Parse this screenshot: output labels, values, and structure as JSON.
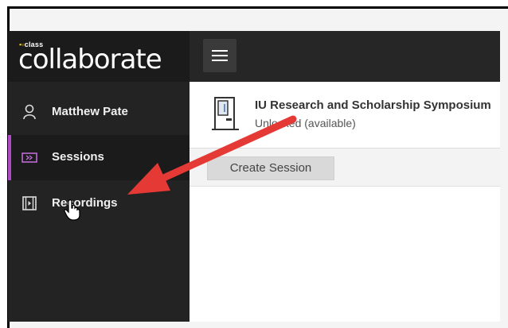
{
  "brand": {
    "small": "class",
    "name": "collaborate"
  },
  "sidebar": {
    "items": [
      {
        "label": "Matthew Pate",
        "icon": "user-icon",
        "active": false
      },
      {
        "label": "Sessions",
        "icon": "sessions-icon",
        "active": true
      },
      {
        "label": "Recordings",
        "icon": "recordings-icon",
        "active": false
      }
    ]
  },
  "topbar": {
    "menu_icon": "hamburger-menu-icon"
  },
  "session": {
    "title": "IU Research and Scholarship Symposium",
    "status": "Unlocked (available)",
    "icon": "door-icon"
  },
  "toolbar": {
    "create_label": "Create Session"
  },
  "annotation": {
    "arrow_color": "#e53935",
    "accent": "#b04ac9"
  }
}
